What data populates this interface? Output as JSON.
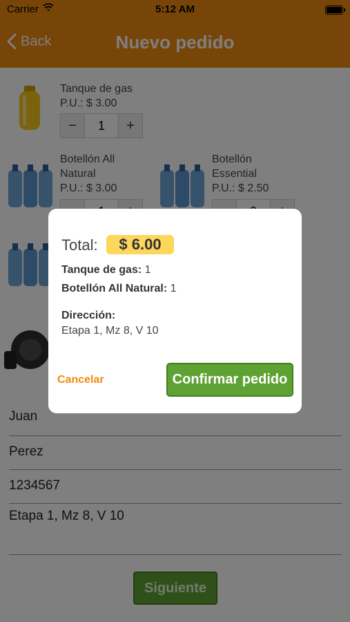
{
  "status": {
    "carrier": "Carrier",
    "time": "5:12 AM"
  },
  "nav": {
    "back": "Back",
    "title": "Nuevo pedido"
  },
  "products": [
    {
      "name": "Tanque de gas",
      "price": "P.U.: $ 3.00",
      "qty": "1"
    },
    {
      "name": "Botellón All Natural",
      "price": "P.U.: $ 3.00",
      "qty": "1"
    },
    {
      "name": "Botellón Essential",
      "price": "P.U.: $ 2.50",
      "qty": "0"
    }
  ],
  "stepper": {
    "minus": "−",
    "plus": "+"
  },
  "form": {
    "first_name": "Juan",
    "last_name": "Perez",
    "phone": "1234567",
    "address": "Etapa 1, Mz 8, V 10"
  },
  "next_button": "Siguiente",
  "modal": {
    "total_label": "Total:",
    "total_value": "$ 6.00",
    "items": [
      {
        "label": "Tanque de gas:",
        "qty": "1"
      },
      {
        "label": "Botellón All Natural:",
        "qty": "1"
      }
    ],
    "address_label": "Dirección:",
    "address_value": "Etapa 1, Mz 8, V 10",
    "cancel": "Cancelar",
    "confirm": "Confirmar pedido"
  },
  "colors": {
    "brand": "#ef8a10",
    "accent": "#5ea233",
    "highlight": "#fcd75c"
  }
}
